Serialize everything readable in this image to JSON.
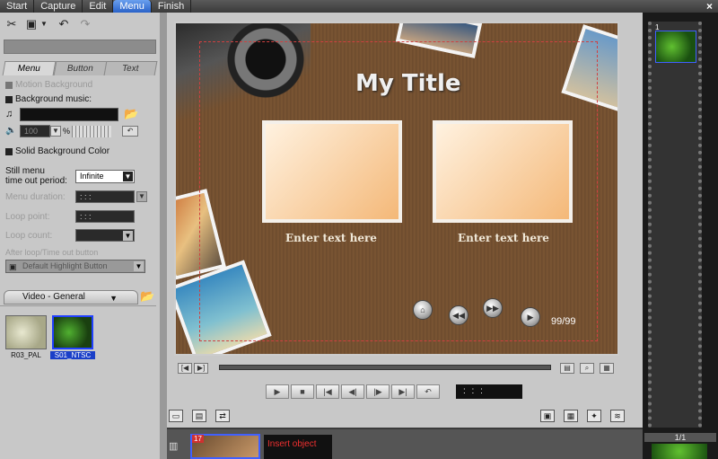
{
  "top_tabs": [
    "Start",
    "Capture",
    "Edit",
    "Menu",
    "Finish"
  ],
  "active_top_tab": "Menu",
  "close_glyph": "×",
  "toolbar": {
    "icons": [
      "scissors-icon",
      "save-icon",
      "undo-icon",
      "redo-icon"
    ]
  },
  "sub_tabs": [
    "Menu",
    "Button",
    "Text"
  ],
  "options": {
    "motion_background": "Motion Background",
    "background_music": "Background music:",
    "volume": "100",
    "percent": "%",
    "solid_bg": "Solid Background Color",
    "still_menu_label_1": "Still menu",
    "still_menu_label_2": "time out period:",
    "still_menu_value": "Infinite",
    "menu_duration": "Menu duration:",
    "loop_point": "Loop point:",
    "loop_count": "Loop count:",
    "after_loop": "After loop/Time out button",
    "highlight_button": "Default Highlight Button",
    "timecode_placeholder": " :  :  :"
  },
  "video_general": "Video - General",
  "thumbnails": [
    {
      "label": "R03_PAL",
      "selected": false
    },
    {
      "label": "S01_NTSC",
      "selected": true
    }
  ],
  "preview": {
    "title": "My Title",
    "enter_text_1": "Enter text here",
    "enter_text_2": "Enter text here",
    "counter": "99/99"
  },
  "transport": {
    "buttons": [
      "▶",
      "■",
      "|◀",
      "◀|",
      "|▶",
      "▶|",
      "↶"
    ],
    "timecode": " :  :  :"
  },
  "timeline": {
    "clip_number": "17",
    "insert_object": "Insert object"
  },
  "filmstrip": {
    "item_number": "1",
    "page_indicator": "1/1"
  }
}
